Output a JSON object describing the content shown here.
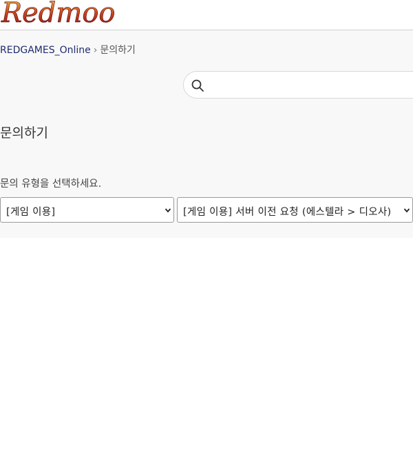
{
  "header": {
    "logo_text": "Redmoon"
  },
  "breadcrumb": {
    "home_label": "REDGAMES_Online",
    "separator": "›",
    "current_label": "문의하기"
  },
  "search": {
    "placeholder": "",
    "icon": "search-icon"
  },
  "main": {
    "title": "문의하기",
    "type_prompt": "문의 유형을 선택하세요.",
    "category_select": {
      "selected": "[게임 이용]",
      "icon": "chevron-down-icon"
    },
    "detail_select": {
      "selected": "[게임 이용] 서버 이전 요청 (에스텔라 > 디오사)",
      "icon": "chevron-down-icon"
    }
  },
  "colors": {
    "link": "#1f2b6e",
    "background_top": "#f8f8f8",
    "logo_red": "#a8161c",
    "logo_gold": "#d69a2a"
  }
}
